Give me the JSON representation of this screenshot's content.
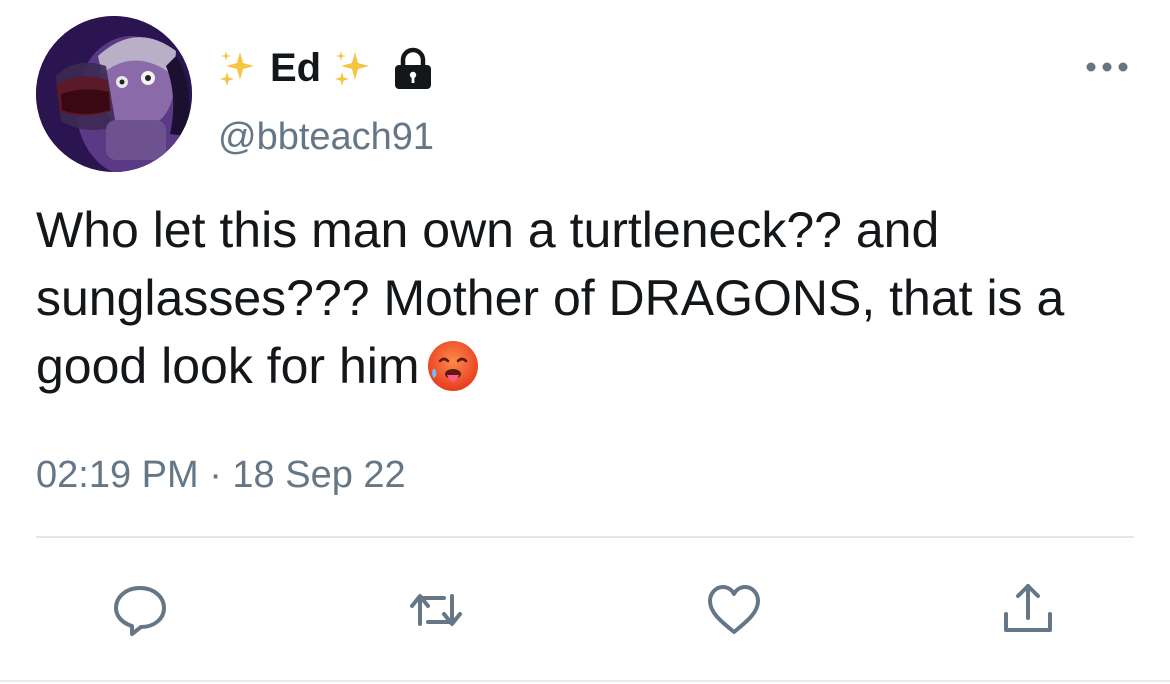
{
  "user": {
    "display_name": "Ed",
    "handle": "@bbteach91",
    "name_decoration_icon": "sparkles-icon",
    "protected_icon": "lock-icon"
  },
  "tweet": {
    "text": "Who let this man own a turtleneck?? and sunglasses??? Mother of DRAGONS, that is a good look for him",
    "emoji": "hot-face-emoji",
    "timestamp": "02:19 PM · 18 Sep 22"
  },
  "actions": {
    "reply_icon": "reply-icon",
    "retweet_icon": "retweet-icon",
    "like_icon": "heart-icon",
    "share_icon": "share-icon",
    "more_icon": "more-icon"
  },
  "colors": {
    "text": "#14171a",
    "secondary": "#657786",
    "icon": "#657786",
    "divider": "#e1e8ed",
    "sparkle": "#f5c542"
  }
}
